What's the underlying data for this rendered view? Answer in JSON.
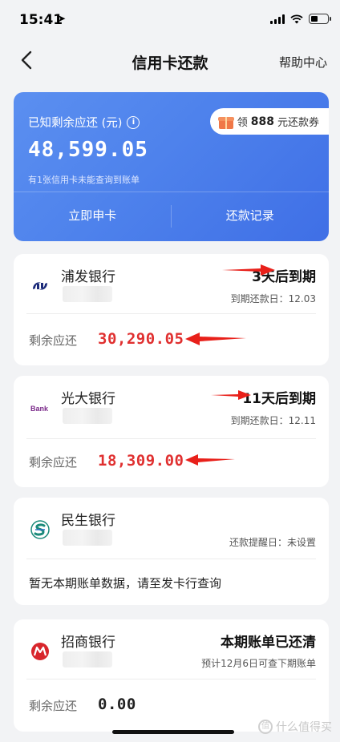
{
  "status_bar": {
    "time": "15:41",
    "location_glyph": "➤"
  },
  "nav": {
    "title": "信用卡还款",
    "help": "帮助中心"
  },
  "summary": {
    "label": "已知剩余应还 (元)",
    "info_glyph": "i",
    "amount": "48,599.05",
    "note": "有1张信用卡未能查询到账单",
    "coupon_prefix": "领",
    "coupon_amount": "888",
    "coupon_suffix": "元还款券",
    "actions": [
      "立即申卡",
      "还款记录"
    ]
  },
  "cards": [
    {
      "bank": "浦发银行",
      "icon": "spdb-logo-icon",
      "status": "3天后到期",
      "due_label": "到期还款日：12.03",
      "remain_label": "剩余应还",
      "remain": "30,290.05"
    },
    {
      "bank": "光大银行",
      "icon": "ceb-logo-icon",
      "icon_text": "Bank",
      "status": "11天后到期",
      "due_label": "到期还款日：12.11",
      "remain_label": "剩余应还",
      "remain": "18,309.00"
    },
    {
      "bank": "民生银行",
      "icon": "cmbc-logo-icon",
      "reminder": "还款提醒日：未设置",
      "message": "暂无本期账单数据，请至发卡行查询"
    },
    {
      "bank": "招商银行",
      "icon": "cmb-logo-icon",
      "status": "本期账单已还清",
      "next_bill": "预计12月6日可查下期账单",
      "remain_label": "剩余应还",
      "remain": "0.00"
    }
  ],
  "watermark": {
    "icon_glyph": "值",
    "text": "什么值得买"
  },
  "colors": {
    "accent_blue": "#4e82ec",
    "amount_red": "#e03030",
    "arrow_red": "#e8201a"
  }
}
